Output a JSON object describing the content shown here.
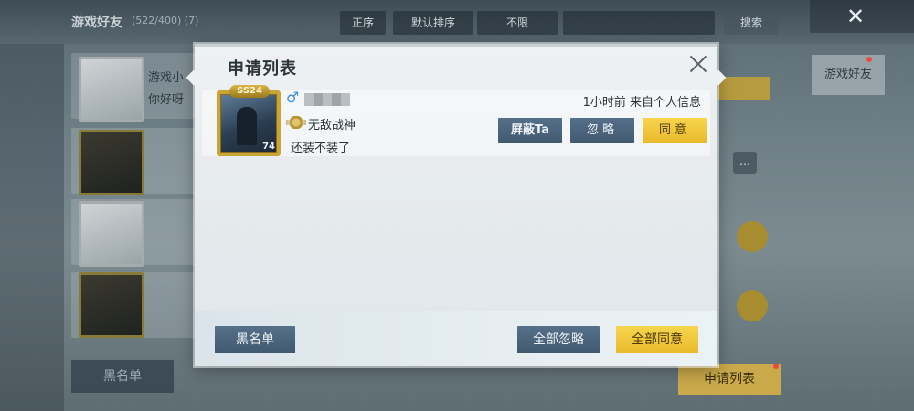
{
  "background": {
    "title": "游戏好友",
    "count": "(522/400) (7)",
    "sort_label": "正序",
    "default_sort_label": "默认排序",
    "limit_label": "不限",
    "search_button": "搜索",
    "close_glyph": "✕",
    "message_name": "游戏小",
    "message_text": "你好呀",
    "right_tag": "游戏好友",
    "blacklist_label": "黑名单",
    "apply_list_label": "申请列表"
  },
  "dialog": {
    "title": "申请列表",
    "requests": [
      {
        "avatar_badge": "SS24",
        "avatar_level": "74",
        "gender": "♂",
        "rank": "无敌战神",
        "message": "还装不装了",
        "meta": "1小时前 来自个人信息",
        "block_label": "屏蔽Ta",
        "ignore_label": "忽略",
        "agree_label": "同意"
      }
    ],
    "footer": {
      "blacklist_label": "黑名单",
      "ignore_all_label": "全部忽略",
      "agree_all_label": "全部同意"
    }
  },
  "colors": {
    "accent_gold": "#f2c93c",
    "button_blue": "#4a637a",
    "gender_male": "#3d8fd6"
  },
  "icons": {
    "close": "close-icon",
    "gender": "male-icon",
    "rank": "rank-badge-icon"
  }
}
